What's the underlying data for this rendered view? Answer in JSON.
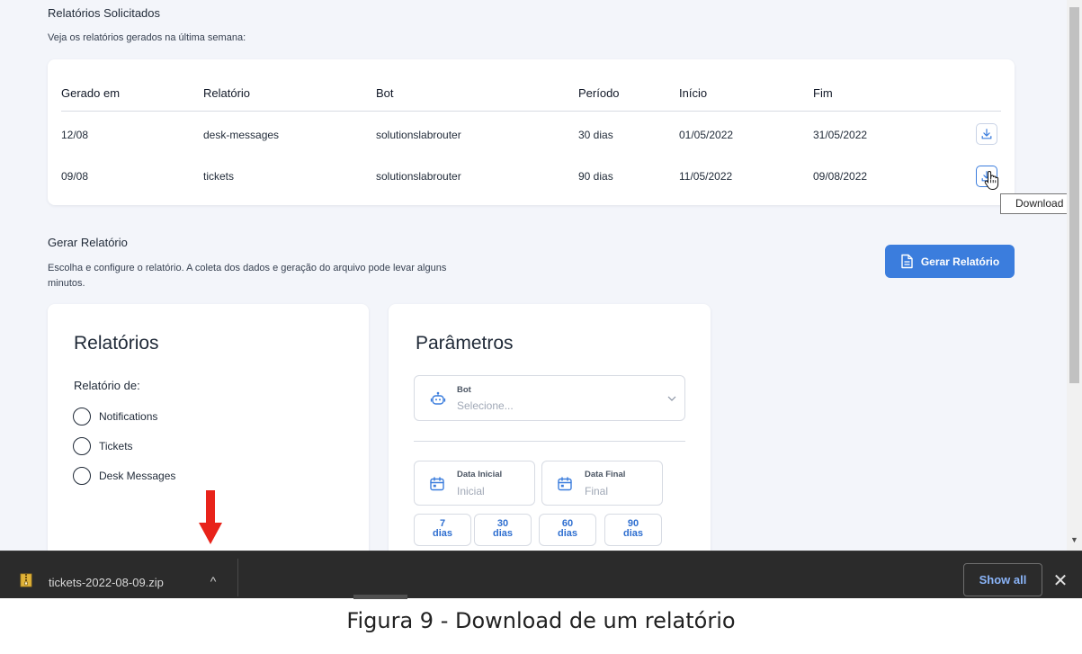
{
  "requested": {
    "title": "Relatórios Solicitados",
    "subtitle": "Veja os relatórios gerados na última semana:",
    "columns": [
      "Gerado em",
      "Relatório",
      "Bot",
      "Período",
      "Início",
      "Fim"
    ],
    "rows": [
      {
        "generated": "12/08",
        "report": "desk-messages",
        "bot": "solutionslabrouter",
        "period": "30 dias",
        "start": "01/05/2022",
        "end": "31/05/2022"
      },
      {
        "generated": "09/08",
        "report": "tickets",
        "bot": "solutionslabrouter",
        "period": "90 dias",
        "start": "11/05/2022",
        "end": "09/08/2022"
      }
    ],
    "download_tooltip": "Download"
  },
  "generate": {
    "title": "Gerar Relatório",
    "description_line1": "Escolha e configure o relatório. A coleta dos dados e geração do arquivo pode levar alguns",
    "description_line2": "minutos.",
    "button_label": "Gerar Relatório"
  },
  "reports_card": {
    "title": "Relatórios",
    "label": "Relatório de:",
    "options": [
      "Notifications",
      "Tickets",
      "Desk Messages"
    ]
  },
  "params_card": {
    "title": "Parâmetros",
    "bot_label": "Bot",
    "bot_placeholder": "Selecione...",
    "start_label": "Data Inicial",
    "start_placeholder": "Inicial",
    "end_label": "Data Final",
    "end_placeholder": "Final",
    "ranges": [
      {
        "num": "7",
        "unit": "dias"
      },
      {
        "num": "30",
        "unit": "dias"
      },
      {
        "num": "60",
        "unit": "dias"
      },
      {
        "num": "90",
        "unit": "dias"
      }
    ]
  },
  "download_shelf": {
    "file_name": "tickets-2022-08-09.zip",
    "show_all": "Show all"
  },
  "caption": "Figura 9 - Download de um relatório",
  "colors": {
    "accent": "#3b7ddd",
    "background": "#f3f5fa",
    "arrow": "#e8231a",
    "shelf": "#2b2b2b"
  },
  "icons": [
    "download-icon",
    "document-icon",
    "bot-icon",
    "calendar-icon",
    "chevron-down-icon",
    "zip-file-icon",
    "chevron-up-icon",
    "close-icon",
    "hand-cursor-icon",
    "arrow-down-annotation"
  ]
}
